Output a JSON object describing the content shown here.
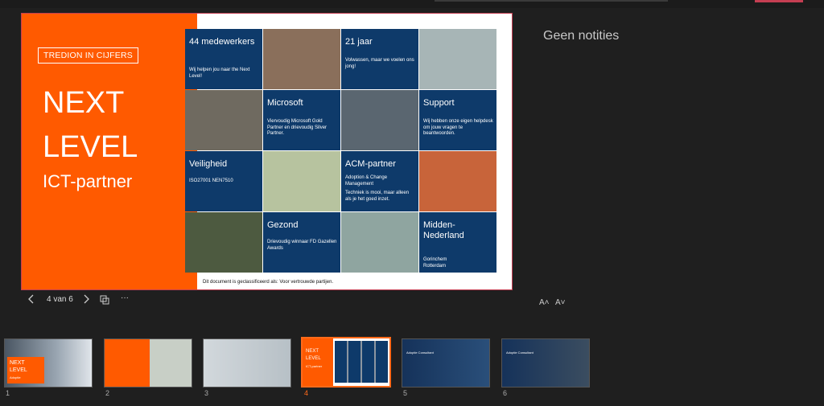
{
  "slide": {
    "tag": "TREDION IN CIJFERS",
    "title_line1": "NEXT",
    "title_line2": "LEVEL",
    "subtitle": "ICT-partner",
    "cards": [
      {
        "title": "44 medewerkers",
        "body": "Wij helpen jou naar the Next Level!"
      },
      {
        "title": "21 jaar",
        "body": "Volwassen, maar we voelen ons jong!"
      },
      {
        "title": "Microsoft",
        "body": "Viervoudig Microsoft Gold Partner en drievoudig Silver Partner."
      },
      {
        "title": "Support",
        "body": "Wij hebben onze eigen helpdesk om jouw vragen te beantwoorden."
      },
      {
        "title": "Veiligheid",
        "body": "ISO27001 NEN7510"
      },
      {
        "title": "ACM-partner",
        "body": "Adoption & Change Management",
        "body2": "Techniek is mooi, maar alleen als je het goed inzet."
      },
      {
        "title": "Gezond",
        "body": "Drievoudig winnaar FD Gazellen Awards"
      },
      {
        "title": "Midden-Nederland",
        "body": "Gorinchem Rotterdam"
      }
    ],
    "footer": "Dit document is geclassificeerd als: Voor vertrouwde partijen."
  },
  "nav": {
    "page_indicator": "4 van 6",
    "prev_icon": "chevron-left-icon",
    "next_icon": "chevron-right-icon",
    "more": "···"
  },
  "notes": {
    "text": "Geen notities"
  },
  "font": {
    "increase": "A˄",
    "decrease": "A˅"
  },
  "thumbnails": [
    {
      "num": "1",
      "line1": "NEXT",
      "line2": "LEVEL",
      "line3": "Adoptie"
    },
    {
      "num": "2"
    },
    {
      "num": "3"
    },
    {
      "num": "4",
      "line1": "NEXT",
      "line2": "LEVEL",
      "line3": "ICT-partner"
    },
    {
      "num": "5",
      "line1": "Adoptie Consultant"
    },
    {
      "num": "6",
      "line1": "Adoptie Consultant"
    }
  ],
  "colors": {
    "orange": "#ff5a00",
    "navy": "#0e3a6a",
    "active": "#ff6a1a"
  }
}
